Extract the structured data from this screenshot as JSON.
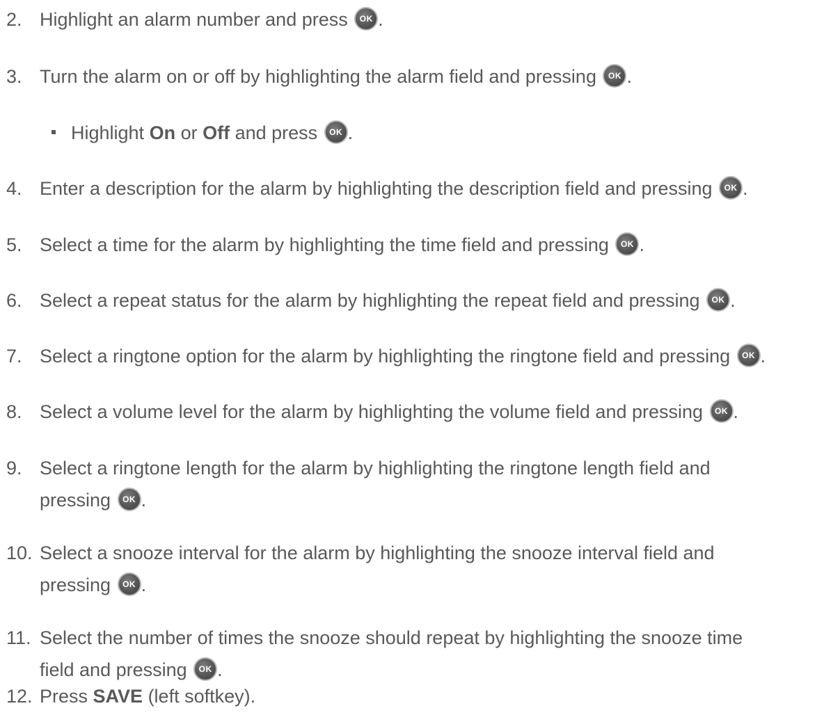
{
  "ok_icon_label": "OK",
  "steps": [
    {
      "num": "2.",
      "text": "Highlight an alarm number and press",
      "end": "."
    },
    {
      "num": "3.",
      "text": "Turn the alarm on or off by highlighting the alarm field and pressing",
      "end": "."
    },
    {
      "bullet": {
        "pre": "Highlight ",
        "b1": "On",
        "mid": " or ",
        "b2": "Off",
        "post": " and press",
        "end": "."
      }
    },
    {
      "num": "4.",
      "text": "Enter a description for the alarm by highlighting the description field and pressing",
      "end": "."
    },
    {
      "num": "5.",
      "text": "Select a time for the alarm by highlighting the time field and pressing",
      "end": "."
    },
    {
      "num": "6.",
      "text": "Select a repeat status for the alarm by highlighting the repeat field and pressing",
      "end": "."
    },
    {
      "num": "7.",
      "text": "Select a ringtone option for the alarm by highlighting the ringtone field and pressing",
      "end": "."
    },
    {
      "num": "8.",
      "text": "Select a volume level for the alarm by highlighting the volume field and pressing",
      "end": "."
    },
    {
      "num": "9.",
      "line1": "Select a ringtone length for the alarm by highlighting the ringtone length field and",
      "line2": "pressing",
      "end": "."
    },
    {
      "num": "10.",
      "line1": "Select a snooze interval for the alarm by highlighting the snooze interval field and",
      "line2": "pressing",
      "end": "."
    },
    {
      "num": "11.",
      "line1": "Select the number of times the snooze should repeat by highlighting the snooze time",
      "line2": "field and pressing",
      "end": "."
    },
    {
      "num": "12.",
      "pre": "Press ",
      "bold": "SAVE",
      "post": " (left softkey)."
    }
  ]
}
